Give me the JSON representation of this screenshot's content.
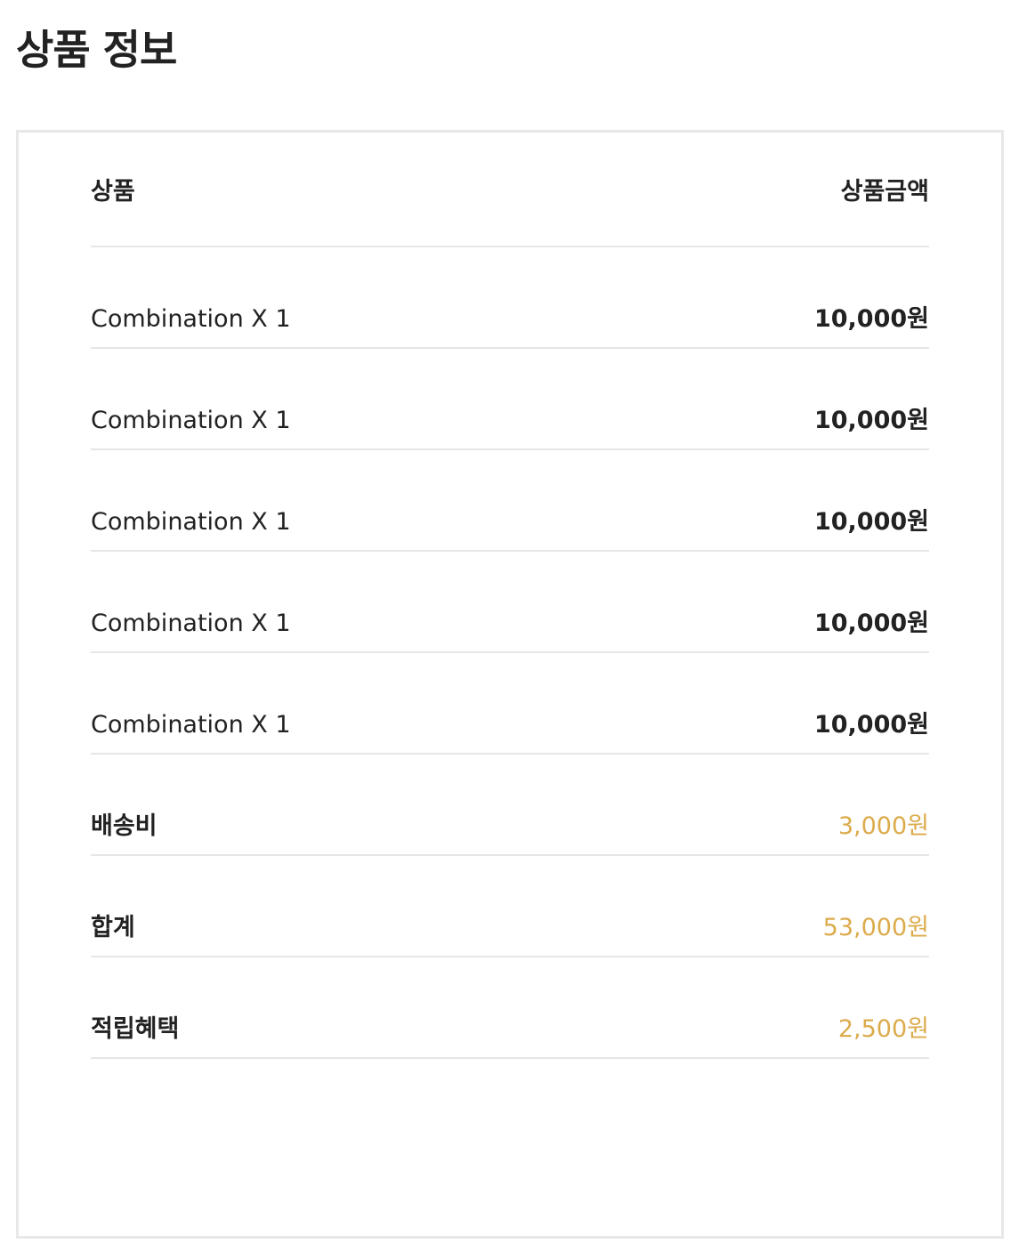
{
  "page": {
    "title": "상품 정보"
  },
  "table": {
    "header": {
      "product": "상품",
      "amount": "상품금액"
    },
    "items": [
      {
        "name": "Combination X 1",
        "price": "10,000원"
      },
      {
        "name": "Combination X 1",
        "price": "10,000원"
      },
      {
        "name": "Combination X 1",
        "price": "10,000원"
      },
      {
        "name": "Combination X 1",
        "price": "10,000원"
      },
      {
        "name": "Combination X 1",
        "price": "10,000원"
      }
    ],
    "shipping": {
      "label": "배송비",
      "value": "3,000원"
    },
    "total": {
      "label": "합계",
      "value": "53,000원"
    },
    "points": {
      "label": "적립혜택",
      "value": "2,500원"
    }
  },
  "colors": {
    "accent": "#dcab4b",
    "text": "#222222",
    "divider": "#e6e6e6",
    "panel_border": "#e8e8e8"
  }
}
